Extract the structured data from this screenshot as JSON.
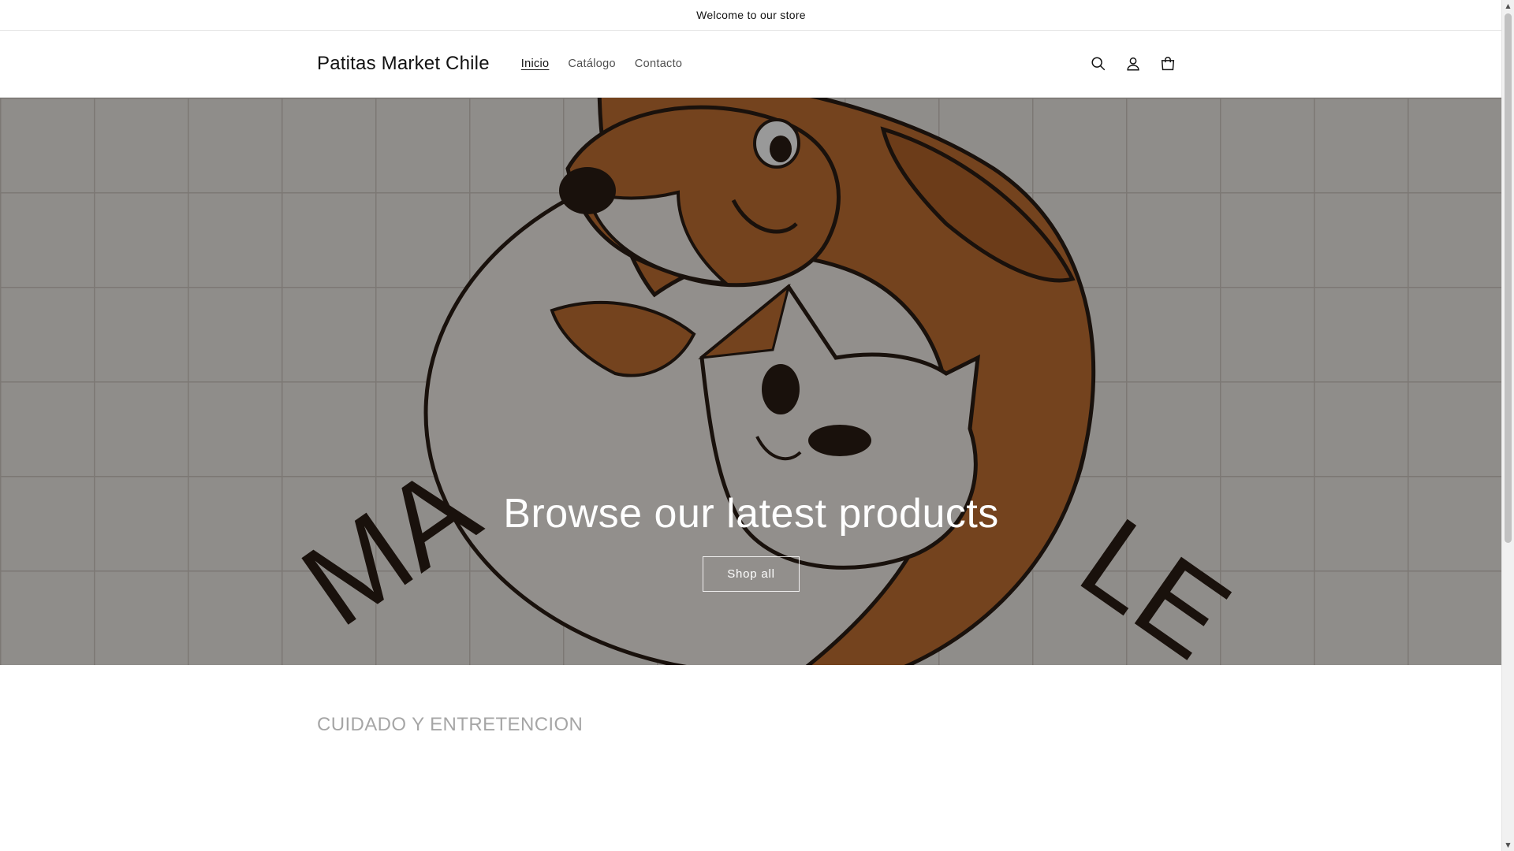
{
  "announcement": {
    "text": "Welcome to our store"
  },
  "header": {
    "brand": "Patitas Market Chile",
    "nav": [
      {
        "label": "Inicio",
        "active": true
      },
      {
        "label": "Catálogo",
        "active": false
      },
      {
        "label": "Contacto",
        "active": false
      }
    ],
    "icons": [
      "search-icon",
      "account-icon",
      "cart-icon"
    ]
  },
  "hero": {
    "title": "Browse our latest products",
    "button_label": "Shop all",
    "logo_letters_left": "MA",
    "logo_letters_right": "LE"
  },
  "collection": {
    "title": "CUIDADO Y ENTRETENCION"
  },
  "colors": {
    "dog_orange": "#c27032",
    "cat_cream": "#f4efe9",
    "outline": "#2b1d14",
    "grid_bg": "#efebe6",
    "grid_line": "#d9d4ce"
  }
}
